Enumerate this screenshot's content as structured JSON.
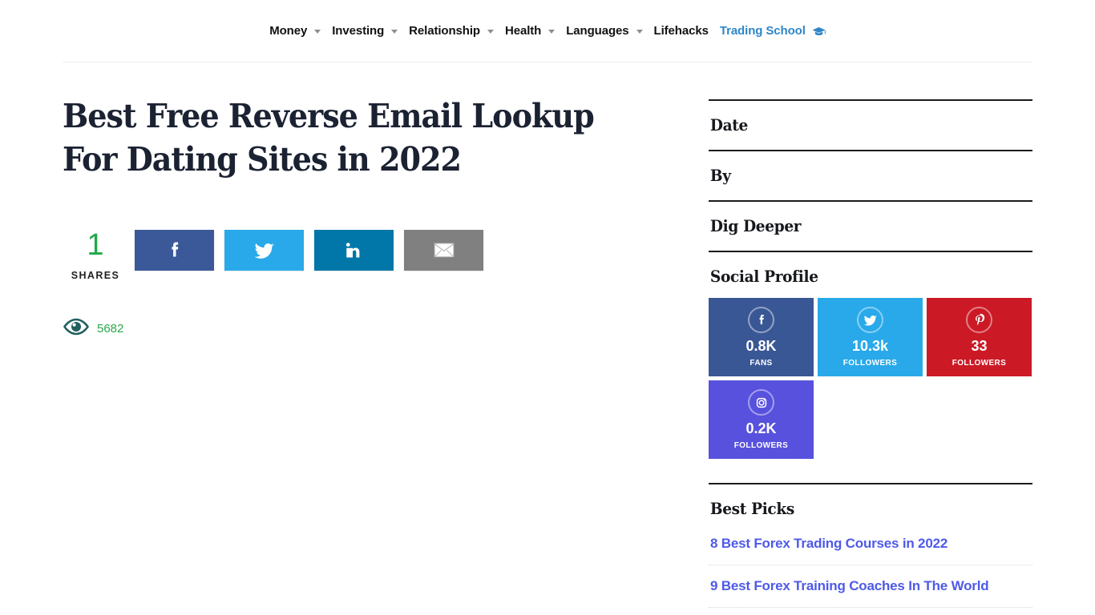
{
  "header": {
    "nav_items": [
      {
        "label": "Money",
        "has_dropdown": true,
        "highlight": false,
        "icon": ""
      },
      {
        "label": "Investing",
        "has_dropdown": true,
        "highlight": false,
        "icon": ""
      },
      {
        "label": "Relationship",
        "has_dropdown": true,
        "highlight": false,
        "icon": ""
      },
      {
        "label": "Health",
        "has_dropdown": true,
        "highlight": false,
        "icon": ""
      },
      {
        "label": "Languages",
        "has_dropdown": true,
        "highlight": false,
        "icon": ""
      },
      {
        "label": "Lifehacks",
        "has_dropdown": false,
        "highlight": false,
        "icon": ""
      },
      {
        "label": "Trading School",
        "has_dropdown": false,
        "highlight": true,
        "icon": "graduation-cap-icon"
      }
    ],
    "highlight_color": "#2e86c8"
  },
  "article": {
    "title": "Best Free Reverse Email Lookup For Dating Sites in 2022",
    "share": {
      "count": "1",
      "count_label": "SHARES",
      "count_color": "#1faa4b",
      "buttons": [
        {
          "name": "facebook",
          "icon": "facebook-icon",
          "color": "#3b5998"
        },
        {
          "name": "twitter",
          "icon": "twitter-icon",
          "color": "#29a9e9"
        },
        {
          "name": "linkedin",
          "icon": "linkedin-icon",
          "color": "#0077a8"
        },
        {
          "name": "email",
          "icon": "envelope-icon",
          "color": "#808080"
        }
      ]
    },
    "views": {
      "icon": "eye-icon",
      "count": "5682",
      "color": "#2aa84a"
    }
  },
  "sidebar": {
    "sections": [
      {
        "heading": "Date"
      },
      {
        "heading": "By"
      },
      {
        "heading": "Dig Deeper"
      },
      {
        "heading": "Social Profile"
      }
    ],
    "social_profile": {
      "heading": "Social Profile",
      "cards": [
        {
          "network": "facebook",
          "icon": "facebook-icon",
          "value": "0.8K",
          "label": "FANS",
          "color": "#3a5795"
        },
        {
          "network": "twitter",
          "icon": "twitter-icon",
          "value": "10.3k",
          "label": "FOLLOWERS",
          "color": "#29a9e9"
        },
        {
          "network": "pinterest",
          "icon": "pinterest-icon",
          "value": "33",
          "label": "FOLLOWERS",
          "color": "#cb1a26"
        },
        {
          "network": "instagram",
          "icon": "instagram-icon",
          "value": "0.2K",
          "label": "FOLLOWERS",
          "color": "#5851dd"
        }
      ]
    },
    "best_picks": {
      "heading": "Best Picks",
      "link_color": "#4e5ae8",
      "links": [
        {
          "label": "8 Best Forex Trading Courses in 2022"
        },
        {
          "label": "9 Best Forex Training Coaches In The World"
        }
      ]
    }
  }
}
